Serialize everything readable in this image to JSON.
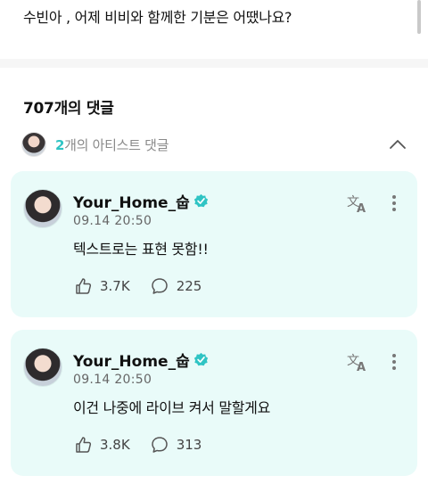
{
  "post": {
    "text": "수빈아 , 어제 비비와 함께한 기분은 어땠나요?"
  },
  "comments_header": {
    "count_label": "707개의 댓글"
  },
  "artist_comments": {
    "count": "2",
    "label": "개의 아티스트 댓글"
  },
  "comments": [
    {
      "author": "Your_Home_숩",
      "time": "09.14 20:50",
      "text": "텍스트로는 표현 못함!!",
      "likes": "3.7K",
      "replies": "225"
    },
    {
      "author": "Your_Home_숩",
      "time": "09.14 20:50",
      "text": "이건 나중에 라이브 켜서 말할게요",
      "likes": "3.8K",
      "replies": "313"
    }
  ],
  "colors": {
    "accent": "#2fc4c4",
    "card_bg": "#e9fbf9"
  },
  "icons": [
    "verified-badge-icon",
    "translate-icon",
    "more-vertical-icon",
    "like-icon",
    "reply-bubble-icon",
    "chevron-up-icon"
  ]
}
